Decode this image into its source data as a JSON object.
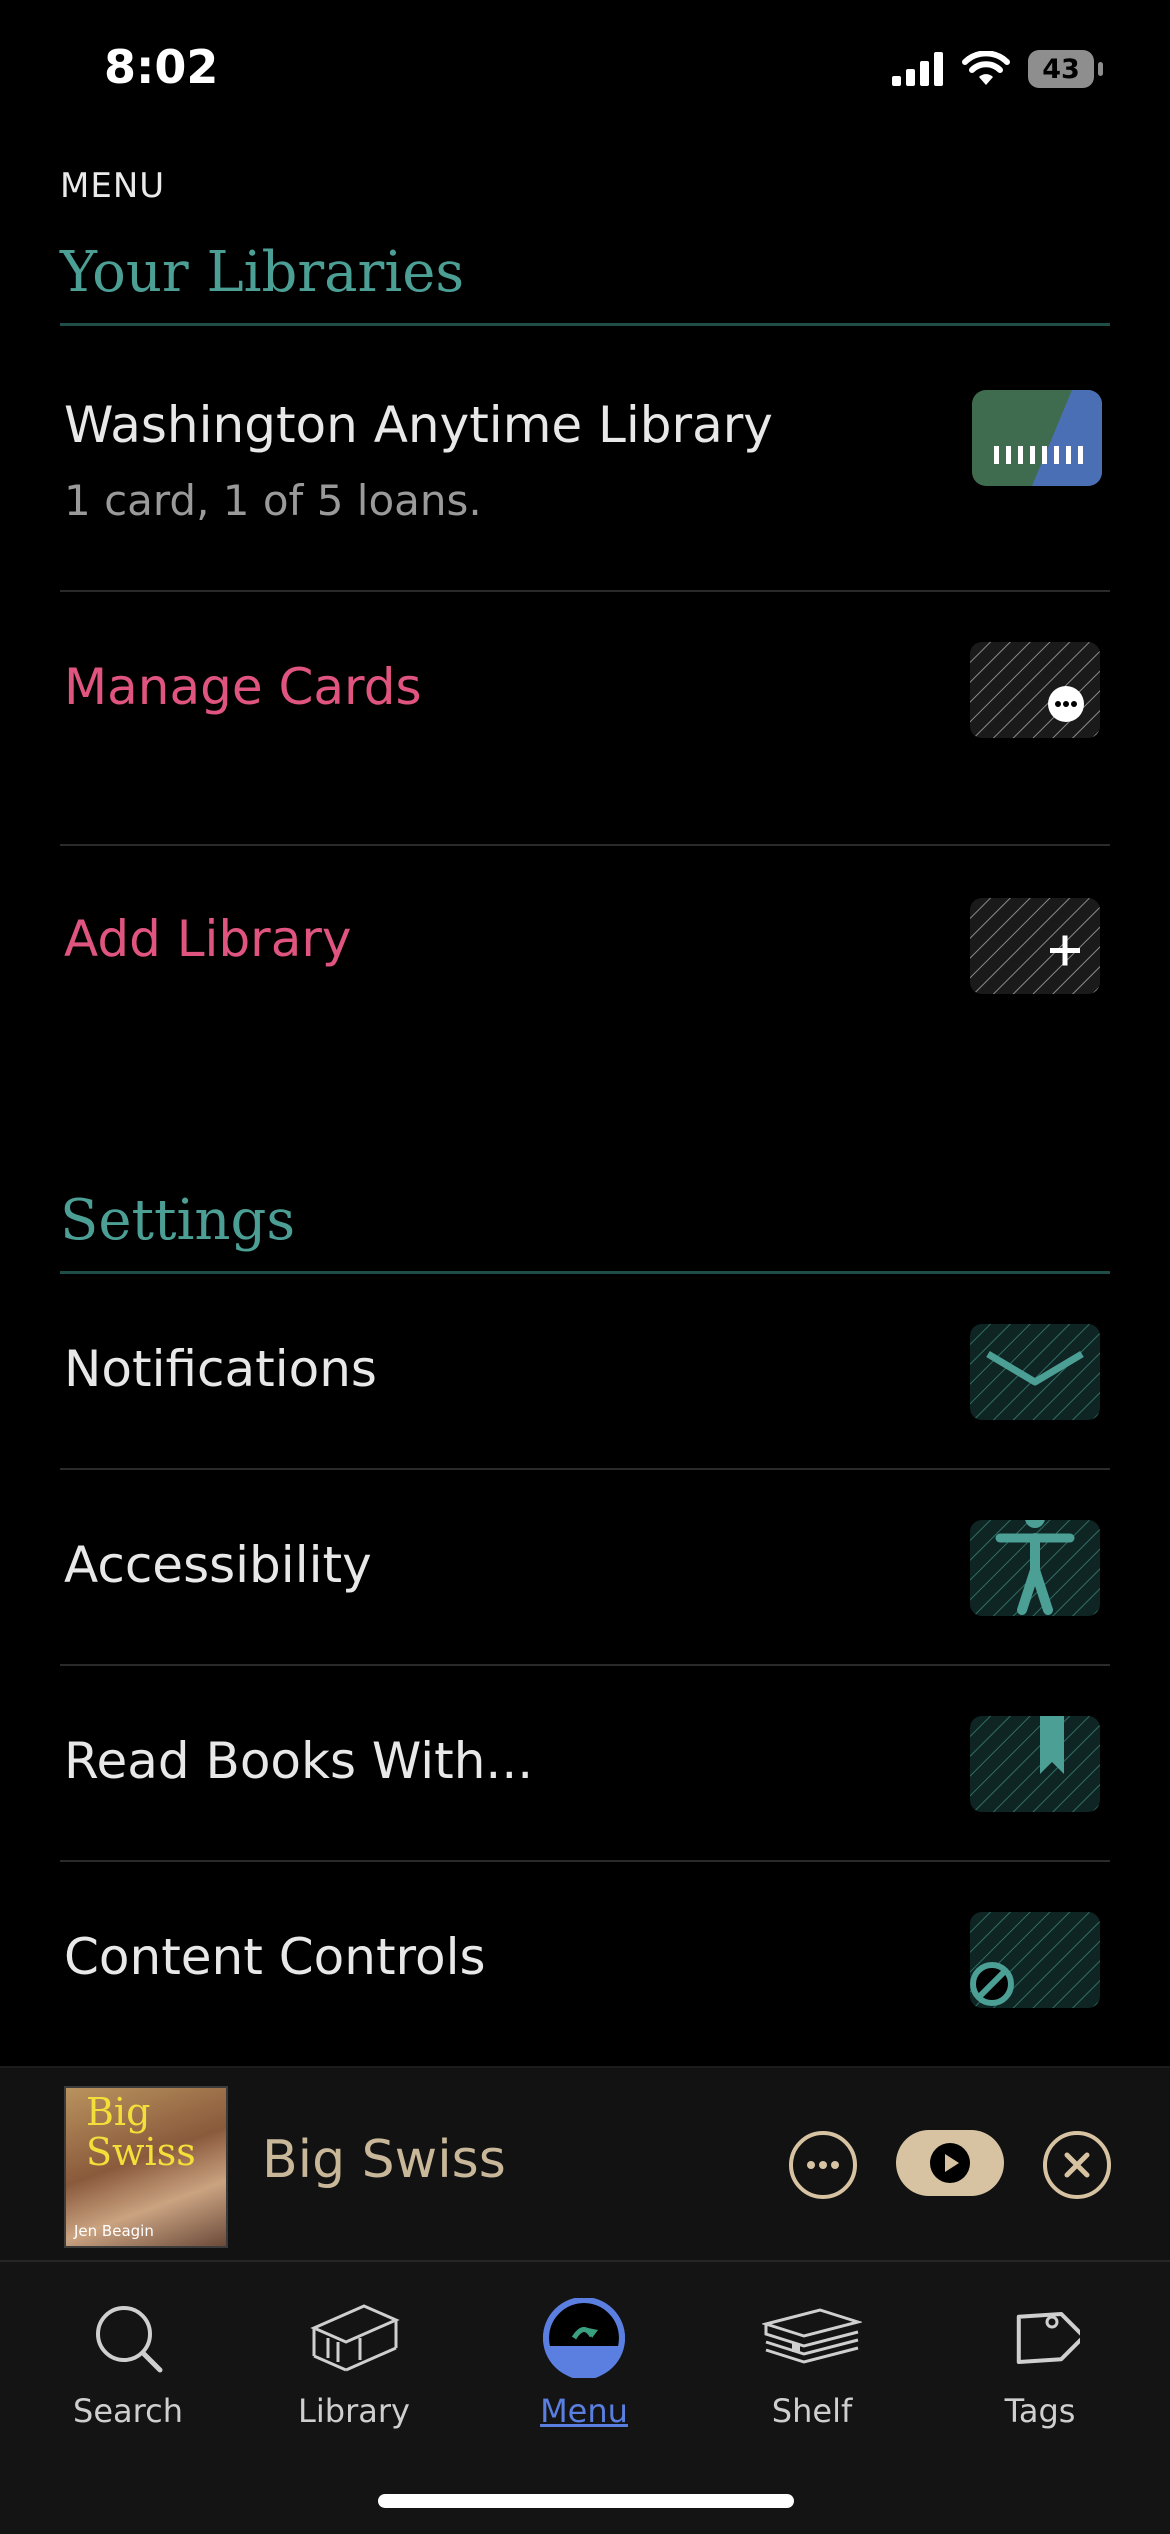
{
  "status_bar": {
    "time": "8:02",
    "battery": "43"
  },
  "header": {
    "title": "MENU"
  },
  "libraries": {
    "section_title": "Your Libraries",
    "library": {
      "name": "Washington Anytime Library",
      "detail": "1 card, 1 of 5 loans."
    },
    "manage_cards_label": "Manage Cards",
    "add_library_label": "Add Library"
  },
  "settings": {
    "section_title": "Settings",
    "items": [
      {
        "label": "Notifications",
        "icon": "envelope-icon"
      },
      {
        "label": "Accessibility",
        "icon": "accessibility-icon"
      },
      {
        "label": "Read Books With...",
        "icon": "bookmark-icon"
      },
      {
        "label": "Content Controls",
        "icon": "block-icon"
      }
    ]
  },
  "player": {
    "title": "Big Swiss",
    "cover_title": "Big Swiss",
    "cover_author": "Jen Beagin"
  },
  "tabs": [
    {
      "label": "Search",
      "icon": "search-icon"
    },
    {
      "label": "Library",
      "icon": "library-icon"
    },
    {
      "label": "Menu",
      "icon": "menu-icon",
      "active": true
    },
    {
      "label": "Shelf",
      "icon": "shelf-icon"
    },
    {
      "label": "Tags",
      "icon": "tag-icon"
    }
  ],
  "colors": {
    "accent_teal": "#4c9f95",
    "accent_pink": "#e0557f",
    "active_tab": "#5b7fe0",
    "player_button": "#d7c3a2"
  }
}
